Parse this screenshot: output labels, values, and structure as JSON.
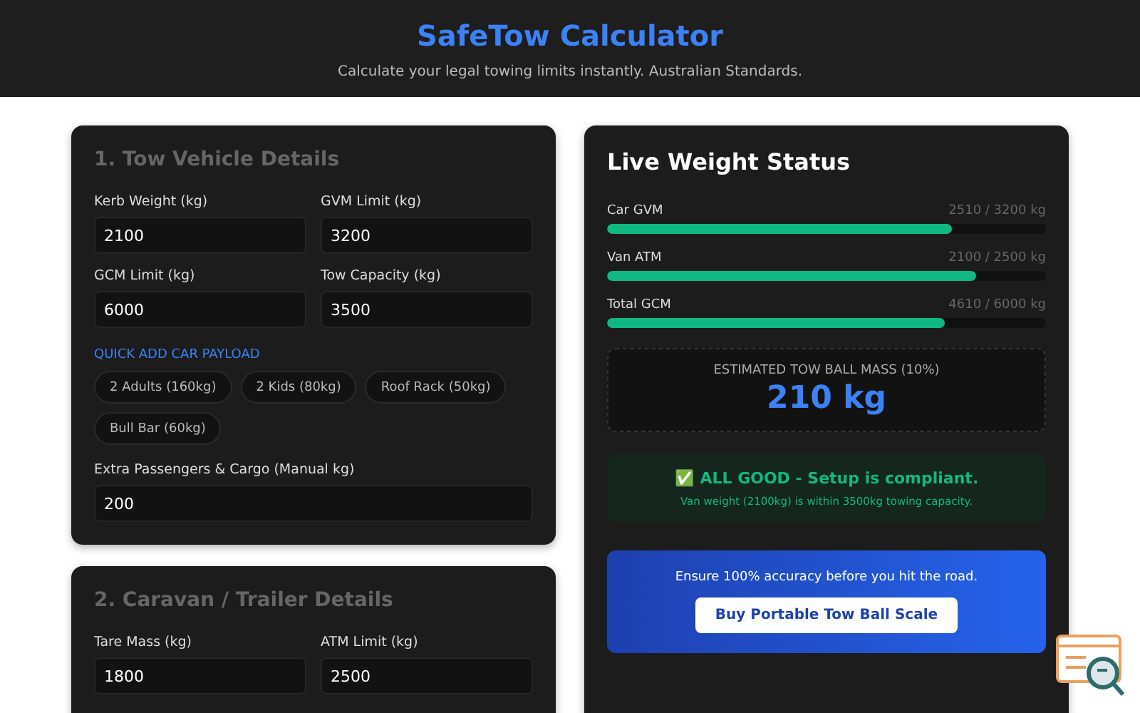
{
  "header": {
    "title": "SafeTow Calculator",
    "subtitle": "Calculate your legal towing limits instantly. Australian Standards."
  },
  "vehicle": {
    "heading": "1. Tow Vehicle Details",
    "fields": [
      {
        "label": "Kerb Weight (kg)",
        "value": "2100"
      },
      {
        "label": "GVM Limit (kg)",
        "value": "3200"
      },
      {
        "label": "GCM Limit (kg)",
        "value": "6000"
      },
      {
        "label": "Tow Capacity (kg)",
        "value": "3500"
      }
    ],
    "quick_add": {
      "label": "QUICK ADD CAR PAYLOAD",
      "chips": [
        "2 Adults (160kg)",
        "2 Kids (80kg)",
        "Roof Rack (50kg)",
        "Bull Bar (60kg)"
      ]
    },
    "extra": {
      "label": "Extra Passengers & Cargo (Manual kg)",
      "value": "200"
    }
  },
  "trailer": {
    "heading": "2. Caravan / Trailer Details",
    "fields": [
      {
        "label": "Tare Mass (kg)",
        "value": "1800"
      },
      {
        "label": "ATM Limit (kg)",
        "value": "2500"
      }
    ]
  },
  "status": {
    "title": "Live Weight Status",
    "meters": [
      {
        "name": "Car GVM",
        "reading": "2510 / 3200 kg",
        "level": 0.785
      },
      {
        "name": "Van ATM",
        "reading": "2100 / 2500 kg",
        "level": 0.84
      },
      {
        "name": "Total GCM",
        "reading": "4610 / 6000 kg",
        "level": 0.768
      }
    ],
    "towball": {
      "label": "ESTIMATED TOW BALL MASS (10%)",
      "value": "210 kg"
    },
    "result": {
      "kind": "ok",
      "headline": "✅ ALL GOOD - Setup is compliant.",
      "detail": "Van weight (2100kg) is within 3500kg towing capacity."
    },
    "promo": {
      "text": "Ensure 100% accuracy before you hit the road.",
      "button": "Buy Portable Tow Ball Scale"
    }
  }
}
